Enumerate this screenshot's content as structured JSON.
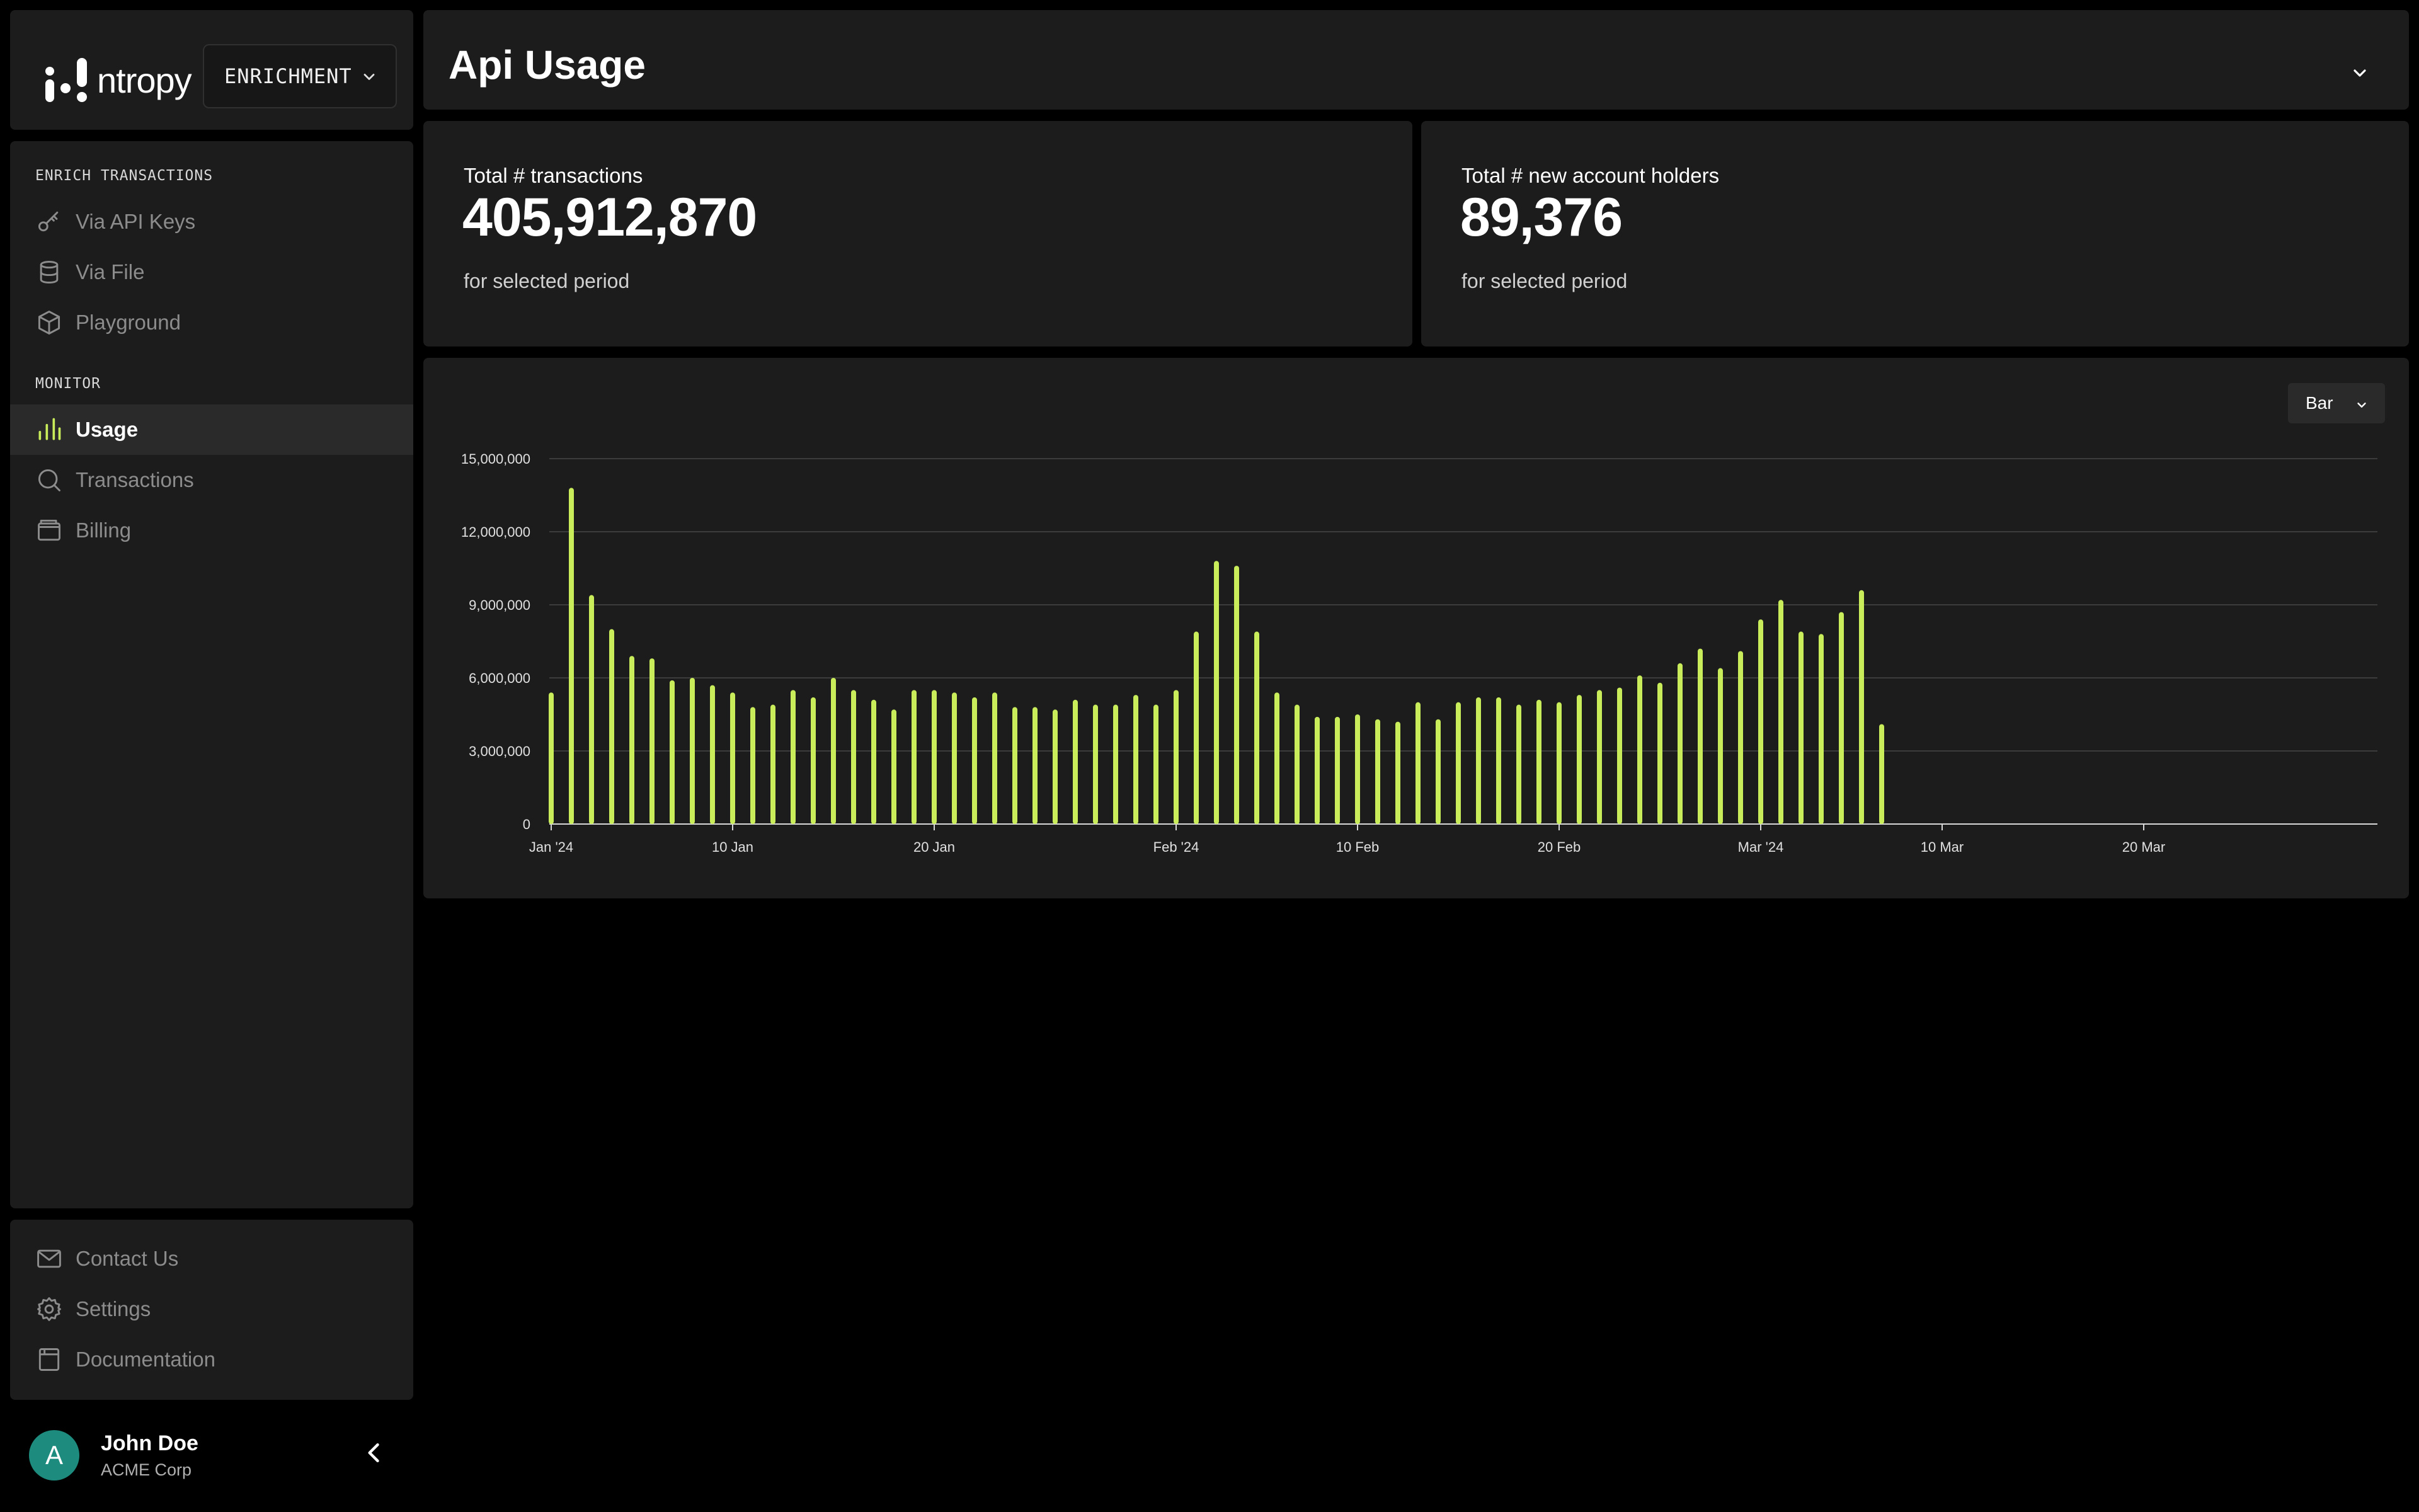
{
  "brand": {
    "logo_text": "ntropy",
    "product_selector": "ENRICHMENT"
  },
  "sidebar": {
    "sections": [
      {
        "title": "ENRICH TRANSACTIONS",
        "items": [
          {
            "label": "Via API Keys",
            "icon": "key-icon"
          },
          {
            "label": "Via File",
            "icon": "database-icon"
          },
          {
            "label": "Playground",
            "icon": "cube-icon"
          }
        ]
      },
      {
        "title": "MONITOR",
        "items": [
          {
            "label": "Usage",
            "icon": "bar-chart-icon",
            "active": true
          },
          {
            "label": "Transactions",
            "icon": "search-icon"
          },
          {
            "label": "Billing",
            "icon": "wallet-icon"
          }
        ]
      }
    ],
    "footer_items": [
      {
        "label": "Contact Us",
        "icon": "mail-icon"
      },
      {
        "label": "Settings",
        "icon": "gear-icon"
      },
      {
        "label": "Documentation",
        "icon": "book-icon"
      }
    ]
  },
  "user": {
    "initial": "A",
    "name": "John Doe",
    "org": "ACME Corp"
  },
  "header": {
    "title": "Api Usage"
  },
  "stats": [
    {
      "label": "Total # transactions",
      "value": "405,912,870",
      "sub": "for selected period"
    },
    {
      "label": "Total # new account holders",
      "value": "89,376",
      "sub": "for selected period"
    }
  ],
  "chart_controls": {
    "type_selector": "Bar"
  },
  "colors": {
    "accent": "#c9ec5a",
    "panel": "#1c1c1c",
    "background": "#000000"
  },
  "chart_data": {
    "type": "bar",
    "x_start": "2024-01-01",
    "x_end": "2024-03-31",
    "x_tick_labels": [
      "Jan '24",
      "10 Jan",
      "20 Jan",
      "Feb '24",
      "10 Feb",
      "20 Feb",
      "Mar '24",
      "10 Mar",
      "20 Mar"
    ],
    "x_tick_dates": [
      "2024-01-01",
      "2024-01-10",
      "2024-01-20",
      "2024-02-01",
      "2024-02-10",
      "2024-02-20",
      "2024-03-01",
      "2024-03-10",
      "2024-03-20"
    ],
    "y_ticks": [
      0,
      3000000,
      6000000,
      9000000,
      12000000,
      15000000
    ],
    "y_tick_labels": [
      "0",
      "3,000,000",
      "6,000,000",
      "9,000,000",
      "12,000,000",
      "15,000,000"
    ],
    "ylim": [
      0,
      15000000
    ],
    "grid": true,
    "values": [
      5400000,
      13800000,
      9400000,
      8000000,
      6900000,
      6800000,
      5900000,
      6000000,
      5700000,
      5400000,
      4800000,
      4900000,
      5500000,
      5200000,
      6000000,
      5500000,
      5100000,
      4700000,
      5500000,
      5500000,
      5400000,
      5200000,
      5400000,
      4800000,
      4800000,
      4700000,
      5100000,
      4900000,
      4900000,
      5300000,
      4900000,
      5500000,
      7900000,
      10800000,
      10600000,
      7900000,
      5400000,
      4900000,
      4400000,
      4400000,
      4500000,
      4300000,
      4200000,
      5000000,
      4300000,
      5000000,
      5200000,
      5200000,
      4900000,
      5100000,
      5000000,
      5300000,
      5500000,
      5600000,
      6100000,
      5800000,
      6600000,
      7200000,
      6400000,
      7100000,
      8400000,
      9200000,
      7900000,
      7800000,
      8700000,
      9600000,
      4100000
    ]
  }
}
